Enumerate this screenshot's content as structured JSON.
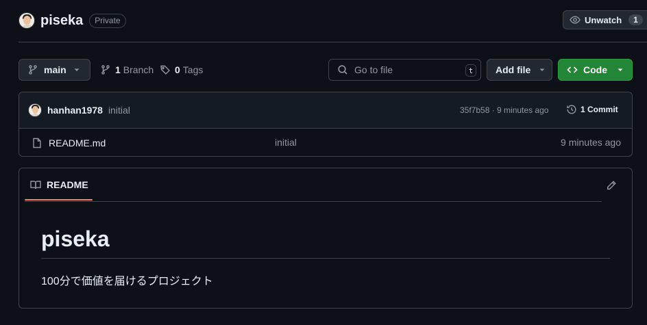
{
  "repo": {
    "name": "piseka",
    "visibility": "Private"
  },
  "watch": {
    "label": "Unwatch",
    "count": "1"
  },
  "toolbar": {
    "branch": "main",
    "branches_count": "1",
    "branches_label": "Branch",
    "tags_count": "0",
    "tags_label": "Tags",
    "goto_placeholder": "Go to file",
    "goto_shortcut": "t",
    "add_file_label": "Add file",
    "code_label": "Code"
  },
  "latest_commit": {
    "author": "hanhan1978",
    "message": "initial",
    "meta": "35f7b58 · 9 minutes ago",
    "commits_label": "1 Commit"
  },
  "files": [
    {
      "name": "README.md",
      "message": "initial",
      "age": "9 minutes ago"
    }
  ],
  "readme": {
    "tab_label": "README",
    "heading": "piseka",
    "paragraph": "100分で価値を届けるプロジェクト"
  },
  "colors": {
    "background": "#0d1117",
    "border": "#3d444d",
    "code_button": "#238636",
    "tab_accent": "#f78166",
    "muted_text": "#9198a1"
  },
  "icons": [
    "eye-icon",
    "branch-icon",
    "tag-icon",
    "search-icon",
    "code-icon",
    "history-icon",
    "file-icon",
    "book-icon",
    "pencil-icon",
    "chevron-down-icon"
  ]
}
